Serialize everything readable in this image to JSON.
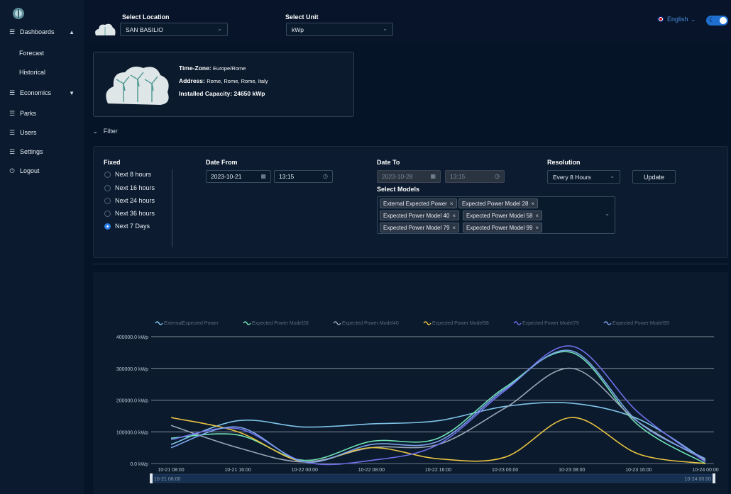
{
  "sidebar": {
    "items": [
      {
        "label": "Dashboards",
        "icon": "list-icon",
        "expanded": true
      },
      {
        "label": "Forecast"
      },
      {
        "label": "Historical"
      },
      {
        "label": "Economics",
        "icon": "list-icon",
        "expanded": false
      },
      {
        "label": "Parks",
        "icon": "list-icon"
      },
      {
        "label": "Users",
        "icon": "list-icon"
      },
      {
        "label": "Settings",
        "icon": "list-icon"
      },
      {
        "label": "Logout",
        "icon": "logout-icon"
      }
    ]
  },
  "header": {
    "location_label": "Select Location",
    "location_value": "SAN BASILIO",
    "unit_label": "Select Unit",
    "unit_value": "kWp",
    "language": "English"
  },
  "park": {
    "timezone_label": "Time-Zone:",
    "timezone_value": "Europe/Rome",
    "address_label": "Address:",
    "address_value": "Rome, Rome, Rome, Italy",
    "capacity_label": "Installed Capacity:",
    "capacity_value": "24650 kWp"
  },
  "filter": {
    "toggle_label": "Filter",
    "fixed_label": "Fixed",
    "options": [
      "Next 8 hours",
      "Next 16 hours",
      "Next 24 hours",
      "Next 36 hours",
      "Next 7 Days"
    ],
    "selected_option": "Next 7 Days",
    "date_from_label": "Date From",
    "date_from": "2023-10-21",
    "time_from": "13:15",
    "date_to_label": "Date To",
    "date_to": "2023-10-28",
    "time_to": "13:15",
    "resolution_label": "Resolution",
    "resolution_value": "Every 8 Hours",
    "update_label": "Update",
    "models_label": "Select Models",
    "models": [
      "External Expected Power",
      "Expected Power Model 28",
      "Expected Power Model 40",
      "Expected Power Model 58",
      "Expected Power Model 79",
      "Expected Power Model 99"
    ]
  },
  "chart_data": {
    "type": "line",
    "x": [
      "10-21 08:00",
      "10-21 16:00",
      "10-22 00:00",
      "10-22 08:00",
      "10-22 16:00",
      "10-23 00:00",
      "10-23 08:00",
      "10-23 16:00",
      "10-24 00:00"
    ],
    "ylim": [
      0,
      400000
    ],
    "yticks": [
      "0.0 kWp",
      "100000.0 kWp",
      "200000.0 kWp",
      "300000.0 kWp",
      "400000.0 kWp"
    ],
    "grid": true,
    "legend_position": "top",
    "zoom_start_label": "10-21 08:00",
    "zoom_end_label": "10-24 00:00",
    "series": [
      {
        "name": "ExternalExpected Power",
        "color": "#7fc3e8",
        "values": [
          60000,
          135000,
          115000,
          125000,
          135000,
          180000,
          190000,
          140000,
          10000
        ]
      },
      {
        "name": "Expected Power Model28",
        "color": "#6fe0b5",
        "values": [
          80000,
          90000,
          10000,
          70000,
          80000,
          240000,
          350000,
          120000,
          0
        ]
      },
      {
        "name": "Expected Power Model40",
        "color": "#9aa6b8",
        "values": [
          120000,
          50000,
          5000,
          50000,
          60000,
          175000,
          300000,
          130000,
          10000
        ]
      },
      {
        "name": "Expected Power Model58",
        "color": "#e8c341",
        "values": [
          145000,
          100000,
          5000,
          50000,
          15000,
          20000,
          145000,
          30000,
          0
        ]
      },
      {
        "name": "Expected Power Model79",
        "color": "#6f6fe8",
        "values": [
          75000,
          110000,
          5000,
          10000,
          60000,
          230000,
          370000,
          160000,
          5000
        ]
      },
      {
        "name": "Expected Power Model99",
        "color": "#7aa2e8",
        "values": [
          50000,
          115000,
          5000,
          60000,
          70000,
          235000,
          355000,
          130000,
          15000
        ]
      }
    ]
  }
}
